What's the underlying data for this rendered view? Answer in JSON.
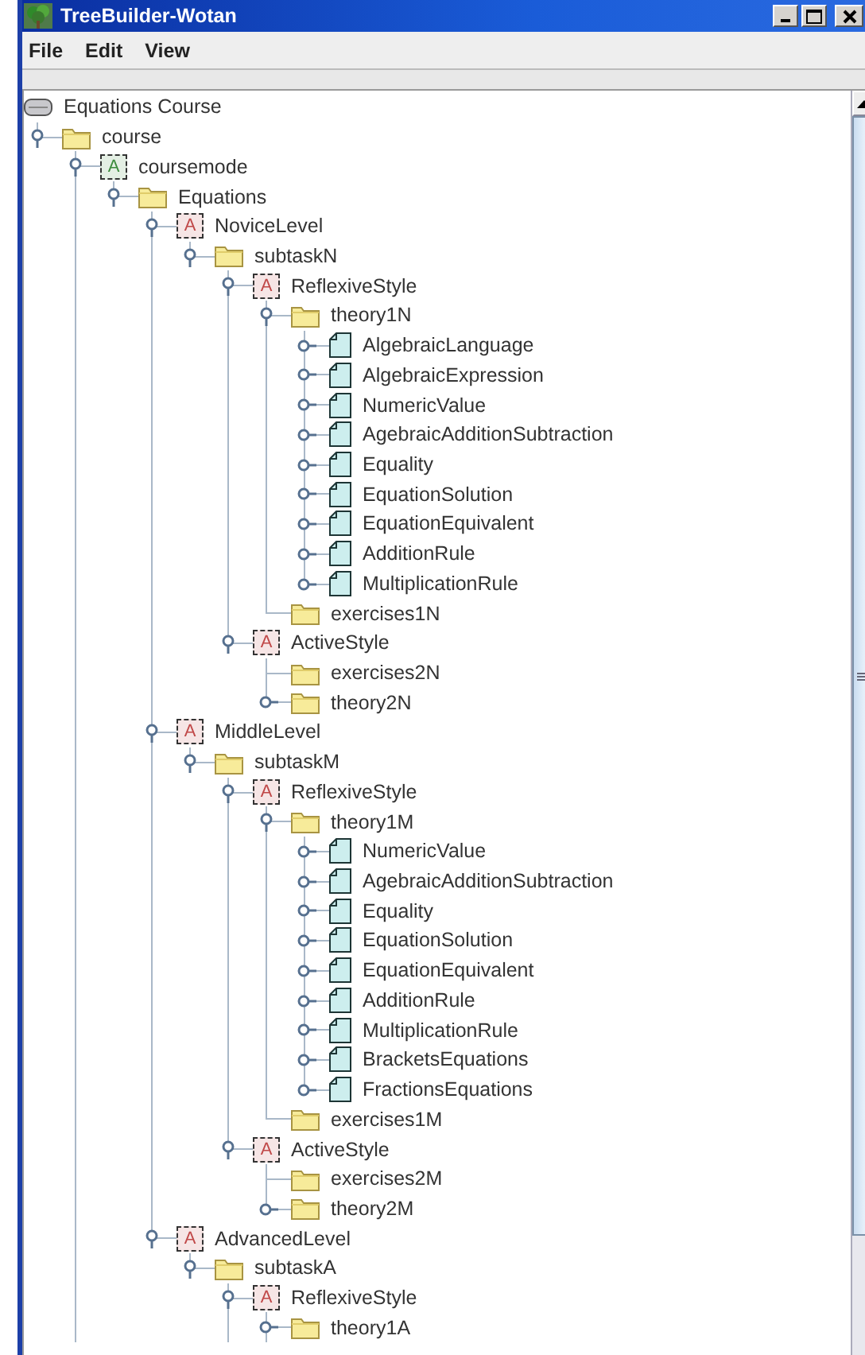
{
  "window": {
    "title": "TreeBuilder-Wotan"
  },
  "menu": [
    "File",
    "Edit",
    "View"
  ],
  "tree": {
    "label": "Equations Course",
    "kind": "root",
    "children": [
      {
        "label": "course",
        "kind": "folder",
        "expanded": true,
        "continues": true,
        "children": [
          {
            "label": "coursemode",
            "kind": "attribute",
            "icon_text": "A",
            "color": "#3c8c3c",
            "expanded": true,
            "children": [
              {
                "label": "Equations",
                "kind": "folder",
                "expanded": true,
                "children": [
                  {
                    "label": "NoviceLevel",
                    "kind": "attribute",
                    "icon_text": "A",
                    "color": "#c04848",
                    "expanded": true,
                    "children": [
                      {
                        "label": "subtaskN",
                        "kind": "folder",
                        "expanded": true,
                        "children": [
                          {
                            "label": "ReflexiveStyle",
                            "kind": "attribute",
                            "icon_text": "A",
                            "color": "#c04848",
                            "expanded": true,
                            "children": [
                              {
                                "label": "theory1N",
                                "kind": "folder",
                                "expanded": true,
                                "children": [
                                  {
                                    "label": "AlgebraicLanguage",
                                    "kind": "document",
                                    "expanded": false
                                  },
                                  {
                                    "label": "AlgebraicExpression",
                                    "kind": "document",
                                    "expanded": false
                                  },
                                  {
                                    "label": "NumericValue",
                                    "kind": "document",
                                    "expanded": false
                                  },
                                  {
                                    "label": "AgebraicAdditionSubtraction",
                                    "kind": "document",
                                    "expanded": false
                                  },
                                  {
                                    "label": "Equality",
                                    "kind": "document",
                                    "expanded": false
                                  },
                                  {
                                    "label": "EquationSolution",
                                    "kind": "document",
                                    "expanded": false
                                  },
                                  {
                                    "label": "EquationEquivalent",
                                    "kind": "document",
                                    "expanded": false
                                  },
                                  {
                                    "label": "AdditionRule",
                                    "kind": "document",
                                    "expanded": false
                                  },
                                  {
                                    "label": "MultiplicationRule",
                                    "kind": "document",
                                    "expanded": false
                                  }
                                ]
                              },
                              {
                                "label": "exercises1N",
                                "kind": "folder",
                                "handle": false
                              }
                            ]
                          },
                          {
                            "label": "ActiveStyle",
                            "kind": "attribute",
                            "icon_text": "A",
                            "color": "#c04848",
                            "expanded": true,
                            "children": [
                              {
                                "label": "exercises2N",
                                "kind": "folder",
                                "handle": false
                              },
                              {
                                "label": "theory2N",
                                "kind": "folder",
                                "expanded": false
                              }
                            ]
                          }
                        ]
                      }
                    ]
                  },
                  {
                    "label": "MiddleLevel",
                    "kind": "attribute",
                    "icon_text": "A",
                    "color": "#c04848",
                    "expanded": true,
                    "children": [
                      {
                        "label": "subtaskM",
                        "kind": "folder",
                        "expanded": true,
                        "children": [
                          {
                            "label": "ReflexiveStyle",
                            "kind": "attribute",
                            "icon_text": "A",
                            "color": "#c04848",
                            "expanded": true,
                            "children": [
                              {
                                "label": "theory1M",
                                "kind": "folder",
                                "expanded": true,
                                "children": [
                                  {
                                    "label": "NumericValue",
                                    "kind": "document",
                                    "expanded": false
                                  },
                                  {
                                    "label": "AgebraicAdditionSubtraction",
                                    "kind": "document",
                                    "expanded": false
                                  },
                                  {
                                    "label": "Equality",
                                    "kind": "document",
                                    "expanded": false
                                  },
                                  {
                                    "label": "EquationSolution",
                                    "kind": "document",
                                    "expanded": false
                                  },
                                  {
                                    "label": "EquationEquivalent",
                                    "kind": "document",
                                    "expanded": false
                                  },
                                  {
                                    "label": "AdditionRule",
                                    "kind": "document",
                                    "expanded": false
                                  },
                                  {
                                    "label": "MultiplicationRule",
                                    "kind": "document",
                                    "expanded": false
                                  },
                                  {
                                    "label": "BracketsEquations",
                                    "kind": "document",
                                    "expanded": false
                                  },
                                  {
                                    "label": "FractionsEquations",
                                    "kind": "document",
                                    "expanded": false
                                  }
                                ]
                              },
                              {
                                "label": "exercises1M",
                                "kind": "folder",
                                "handle": false
                              }
                            ]
                          },
                          {
                            "label": "ActiveStyle",
                            "kind": "attribute",
                            "icon_text": "A",
                            "color": "#c04848",
                            "expanded": true,
                            "children": [
                              {
                                "label": "exercises2M",
                                "kind": "folder",
                                "handle": false
                              },
                              {
                                "label": "theory2M",
                                "kind": "folder",
                                "expanded": false
                              }
                            ]
                          }
                        ]
                      }
                    ]
                  },
                  {
                    "label": "AdvancedLevel",
                    "kind": "attribute",
                    "icon_text": "A",
                    "color": "#c04848",
                    "expanded": true,
                    "children": [
                      {
                        "label": "subtaskA",
                        "kind": "folder",
                        "expanded": true,
                        "continues": true,
                        "children": [
                          {
                            "label": "ReflexiveStyle",
                            "kind": "attribute",
                            "icon_text": "A",
                            "color": "#c04848",
                            "expanded": true,
                            "continues": true,
                            "children": [
                              {
                                "label": "theory1A",
                                "kind": "folder",
                                "expanded": false
                              }
                            ]
                          }
                        ]
                      }
                    ]
                  }
                ]
              }
            ]
          }
        ]
      }
    ]
  }
}
